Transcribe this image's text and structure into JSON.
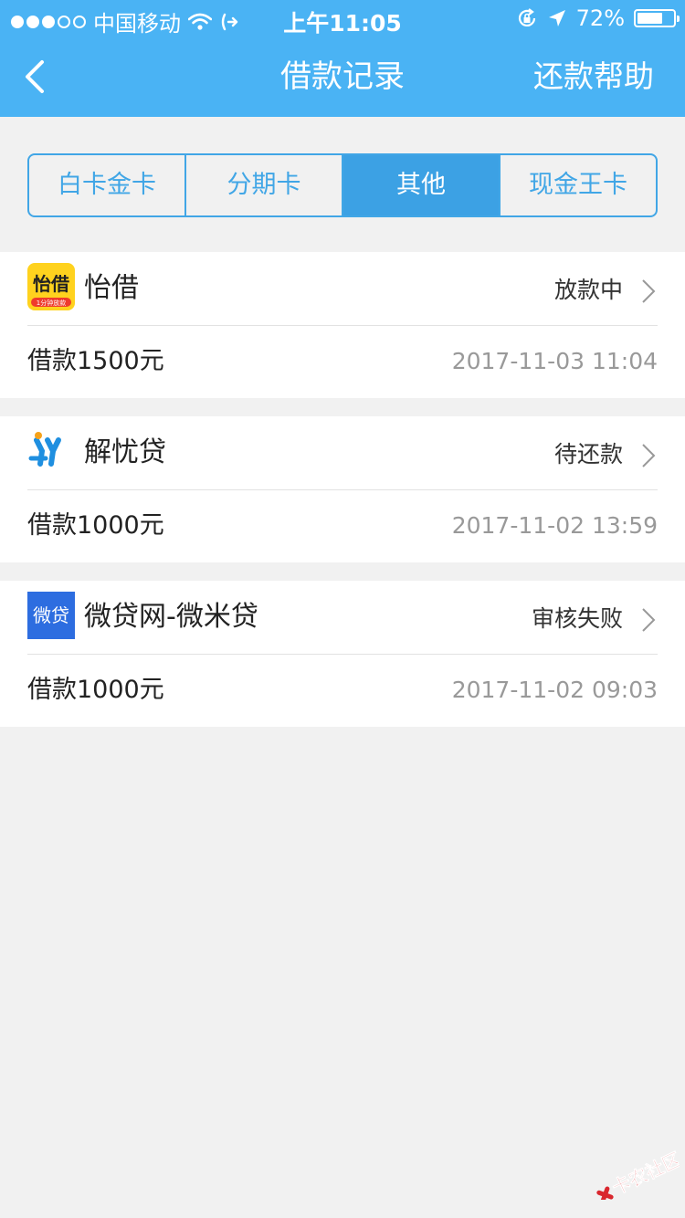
{
  "status_bar": {
    "carrier": "中国移动",
    "time": "上午11:05",
    "battery": "72%",
    "battery_level": 0.72,
    "signal_bars": 3
  },
  "header": {
    "back_icon": "chevron-left-icon",
    "title": "借款记录",
    "help_label": "还款帮助"
  },
  "tabs": [
    {
      "label": "白卡金卡",
      "active": false
    },
    {
      "label": "分期卡",
      "active": false
    },
    {
      "label": "其他",
      "active": true
    },
    {
      "label": "现金王卡",
      "active": false
    }
  ],
  "records": [
    {
      "name": "怡借",
      "status": "放款中",
      "amount": "借款1500元",
      "time": "2017-11-03 11:04",
      "logo_text": "怡借",
      "logo_subtext": "1分钟放款"
    },
    {
      "name": "解忧贷",
      "status": "待还款",
      "amount": "借款1000元",
      "time": "2017-11-02 13:59"
    },
    {
      "name": "微贷网-微米贷",
      "status": "审核失败",
      "amount": "借款1000元",
      "time": "2017-11-02 09:03",
      "logo_text": "微贷"
    }
  ],
  "watermark": {
    "text": "卡农社区"
  },
  "colors": {
    "header": "#4ab3f4",
    "tab_accent": "#3ca1e4",
    "yijie_logo": "#ffd21e",
    "weidai_logo": "#2d6de0"
  }
}
